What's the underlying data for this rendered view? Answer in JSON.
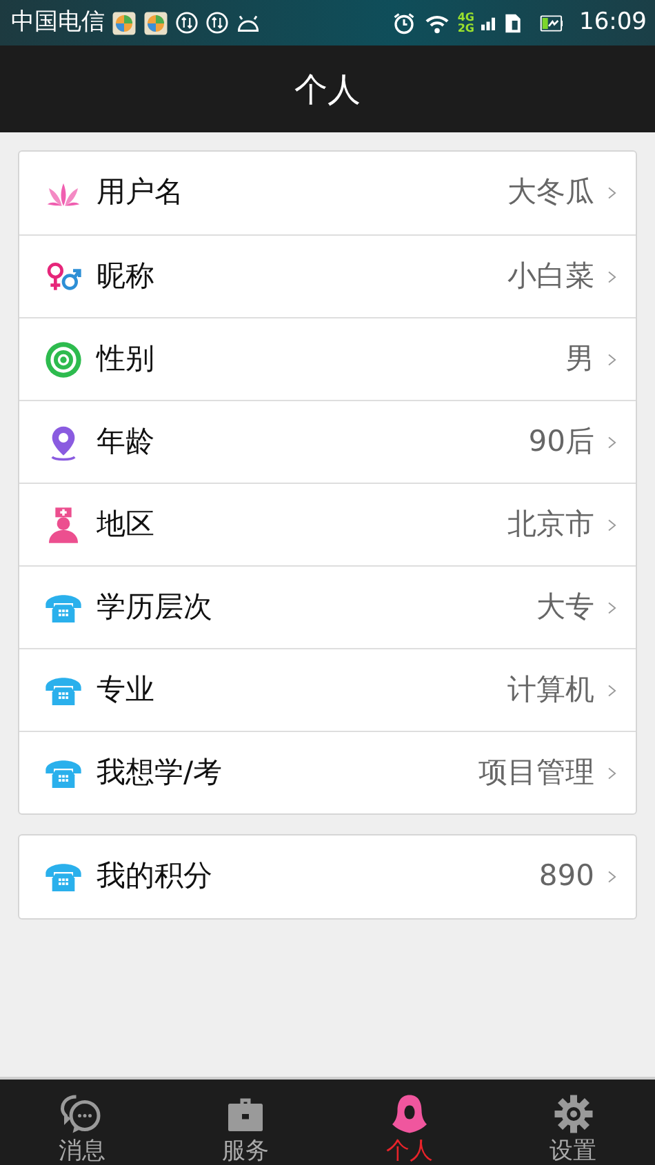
{
  "status_bar": {
    "carrier": "中国电信",
    "network_top": "4G",
    "network_bottom": "2G",
    "time": "16:09"
  },
  "header": {
    "title": "个人"
  },
  "groups": [
    {
      "rows": [
        {
          "label": "用户名",
          "value": "大冬瓜"
        },
        {
          "label": "昵称",
          "value": "小白菜"
        },
        {
          "label": "性别",
          "value": "男"
        },
        {
          "label": "年龄",
          "value": "90后"
        },
        {
          "label": "地区",
          "value": "北京市"
        },
        {
          "label": "学历层次",
          "value": "大专"
        },
        {
          "label": "专业",
          "value": "计算机"
        },
        {
          "label": "我想学/考",
          "value": "项目管理"
        }
      ]
    },
    {
      "rows": [
        {
          "label": "我的积分",
          "value": "890"
        }
      ]
    }
  ],
  "tab_bar": [
    {
      "label": "消息",
      "selected": false
    },
    {
      "label": "服务",
      "selected": false
    },
    {
      "label": "个人",
      "selected": true
    },
    {
      "label": "设置",
      "selected": false
    }
  ]
}
